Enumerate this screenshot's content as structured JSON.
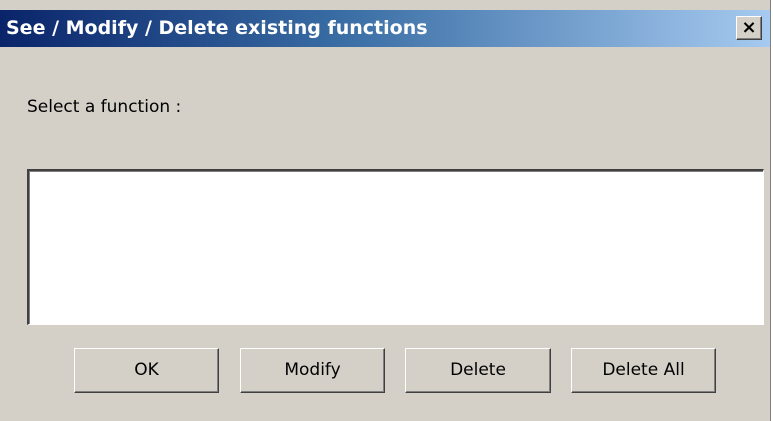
{
  "window": {
    "title": "See / Modify / Delete existing functions",
    "close_glyph": "×",
    "close_icon": "close-icon"
  },
  "content": {
    "prompt_label": "Select a function :",
    "function_list": []
  },
  "buttons": {
    "ok_label": "OK",
    "modify_label": "Modify",
    "delete_label": "Delete",
    "delete_all_label": "Delete All"
  },
  "colors": {
    "title_bar_start": "#0a246a",
    "title_bar_end": "#a6caf0",
    "dialog_face": "#d4d0c8",
    "list_background": "#ffffff"
  }
}
